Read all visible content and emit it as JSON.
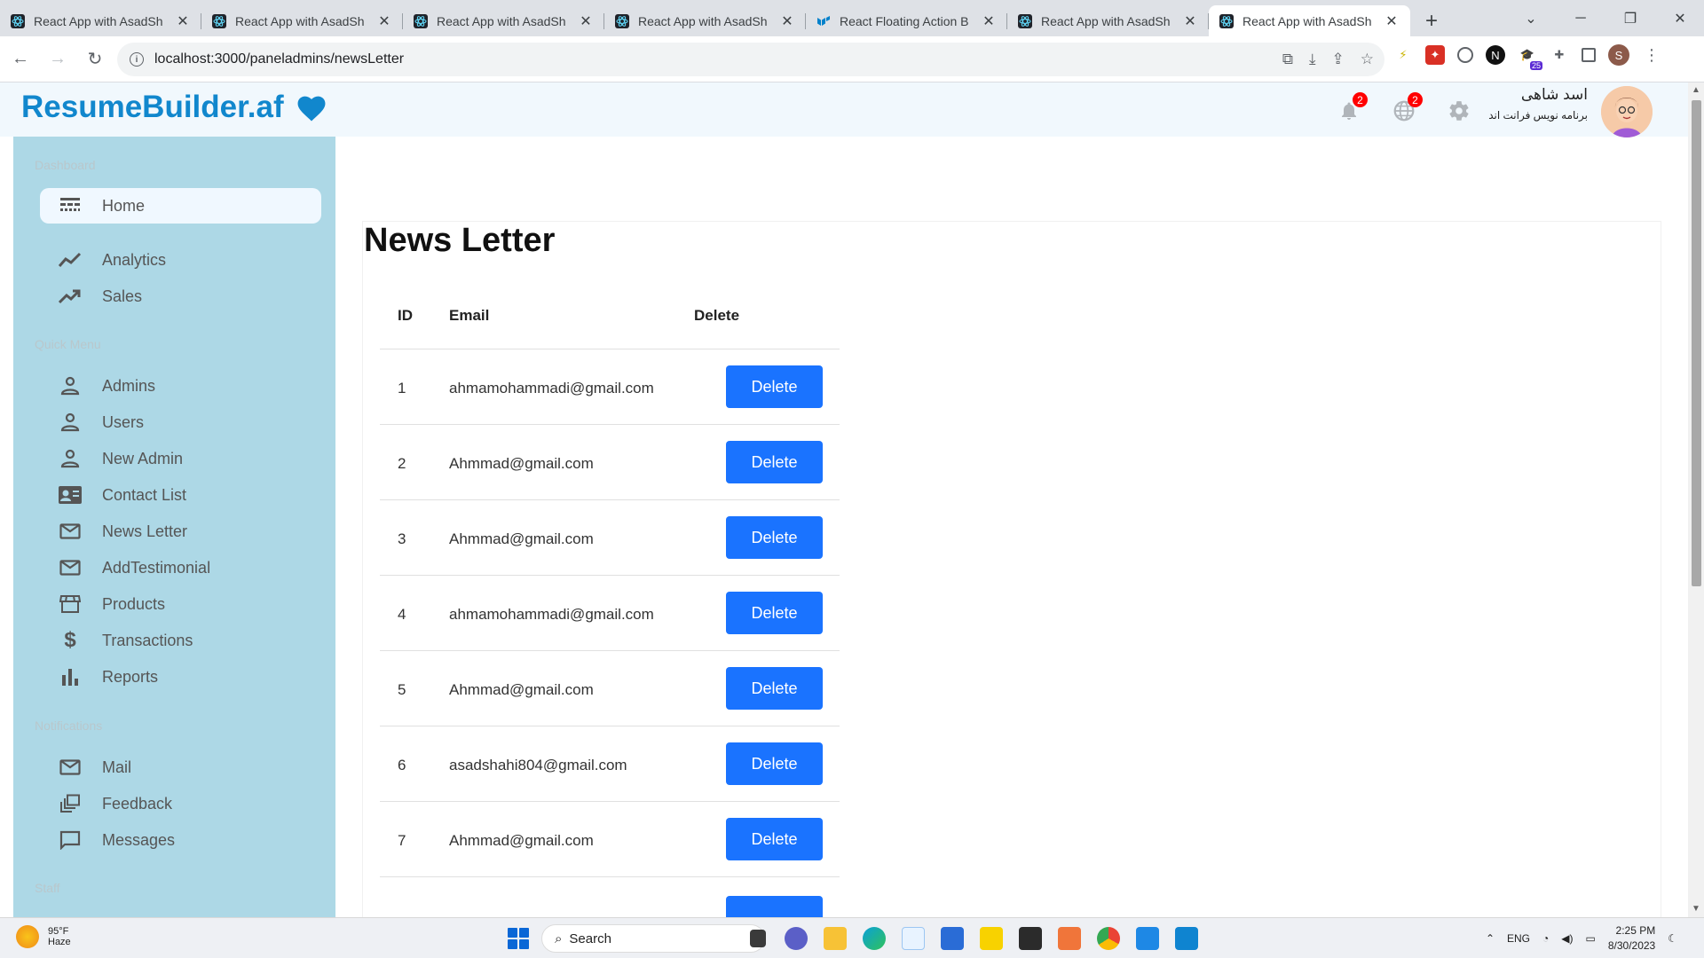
{
  "browser": {
    "tabs": [
      {
        "title": "React App with AsadSh",
        "active": false
      },
      {
        "title": "React App with AsadSh",
        "active": false
      },
      {
        "title": "React App with AsadSh",
        "active": false
      },
      {
        "title": "React App with AsadSh",
        "active": false
      },
      {
        "title": "React Floating Action B",
        "active": false
      },
      {
        "title": "React App with AsadSh",
        "active": false
      },
      {
        "title": "React App with AsadSh",
        "active": true
      }
    ],
    "url": "localhost:3000/paneladmins/newsLetter",
    "profile_initial": "S",
    "extension_badge": "25"
  },
  "header": {
    "brand": "ResumeBuilder.af",
    "notifications_count": "2",
    "language_count": "2",
    "user_name": "اسد شاهی",
    "user_role": "برنامه نویس فرانت اند"
  },
  "sidebar": {
    "sections": {
      "dashboard": "Dashboard",
      "quick_menu": "Quick Menu",
      "notifications": "Notifications",
      "staff": "Staff"
    },
    "items": [
      {
        "label": "Home"
      },
      {
        "label": "Analytics"
      },
      {
        "label": "Sales"
      },
      {
        "label": "Admins"
      },
      {
        "label": "Users"
      },
      {
        "label": "New Admin"
      },
      {
        "label": "Contact List"
      },
      {
        "label": "News Letter"
      },
      {
        "label": "AddTestimonial"
      },
      {
        "label": "Products"
      },
      {
        "label": "Transactions"
      },
      {
        "label": "Reports"
      },
      {
        "label": "Mail"
      },
      {
        "label": "Feedback"
      },
      {
        "label": "Messages"
      }
    ]
  },
  "main": {
    "title": "News Letter",
    "columns": [
      "ID",
      "Email",
      "Delete"
    ],
    "rows": [
      {
        "id": "1",
        "email": "ahmamohammadi@gmail.com",
        "action": "Delete"
      },
      {
        "id": "2",
        "email": "Ahmmad@gmail.com",
        "action": "Delete"
      },
      {
        "id": "3",
        "email": "Ahmmad@gmail.com",
        "action": "Delete"
      },
      {
        "id": "4",
        "email": "ahmamohammadi@gmail.com",
        "action": "Delete"
      },
      {
        "id": "5",
        "email": "Ahmmad@gmail.com",
        "action": "Delete"
      },
      {
        "id": "6",
        "email": "asadshahi804@gmail.com",
        "action": "Delete"
      },
      {
        "id": "7",
        "email": "Ahmmad@gmail.com",
        "action": "Delete"
      }
    ]
  },
  "taskbar": {
    "temperature": "95°F",
    "weather": "Haze",
    "search_label": "Search",
    "language": "ENG",
    "time": "2:25 PM",
    "date": "8/30/2023"
  },
  "colors": {
    "brand": "#1187cd",
    "sidebar_bg": "#add8e6",
    "delete_button": "#1a73ff",
    "badge": "#ff0000"
  }
}
